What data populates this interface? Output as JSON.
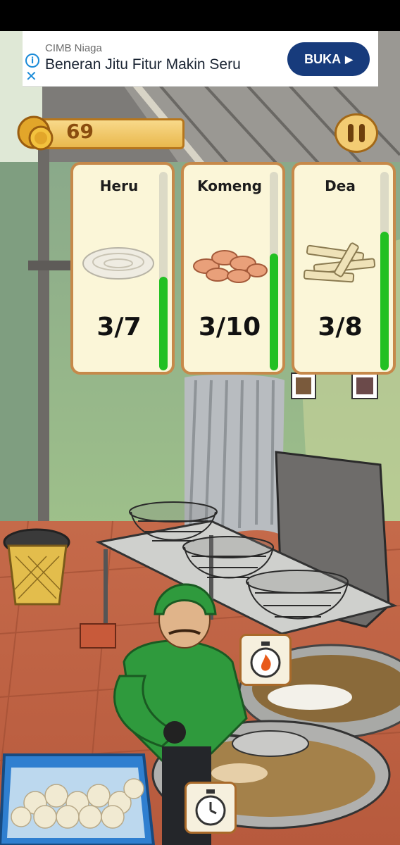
{
  "ad": {
    "brand": "CIMB Niaga",
    "headline": "Beneran Jitu Fitur Makin Seru",
    "cta": "BUKA",
    "icons": [
      "info-icon",
      "close-icon",
      "play-arrow-icon"
    ]
  },
  "hud": {
    "coins": "69",
    "icons": [
      "coin-stack-icon",
      "pause-icon"
    ]
  },
  "orders": [
    {
      "name": "Heru",
      "quantity": "3/7",
      "progress": 0.47,
      "food": "white-crackers"
    },
    {
      "name": "Komeng",
      "quantity": "3/10",
      "progress": 0.59,
      "food": "fried-chips"
    },
    {
      "name": "Dea",
      "quantity": "3/8",
      "progress": 0.7,
      "food": "cracker-sticks"
    }
  ],
  "stations": {
    "icons": [
      "fire-timer-icon",
      "stopwatch-icon"
    ]
  },
  "colors": {
    "progress": "#22c022",
    "card_border": "#c6894a",
    "ad_button": "#173b7c",
    "vendor_jacket": "#2f9a3d"
  }
}
